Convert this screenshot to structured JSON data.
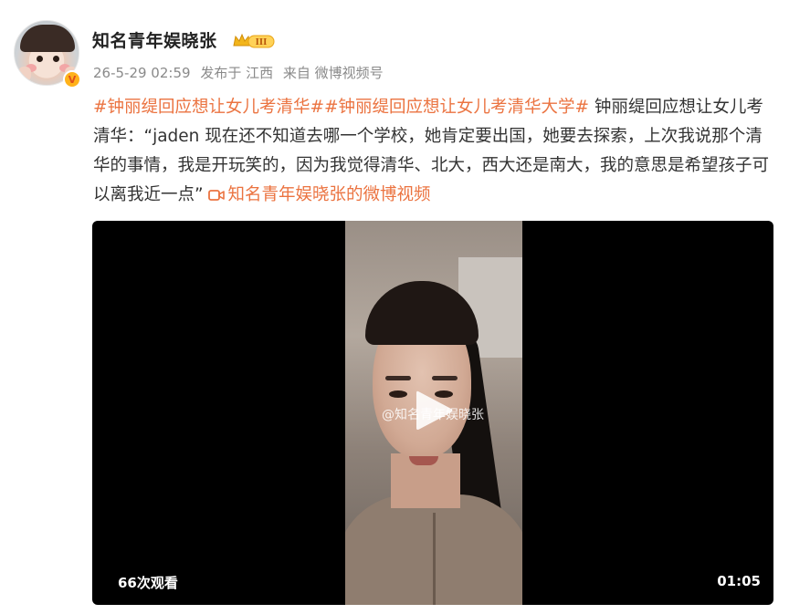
{
  "author": {
    "name": "知名青年娱晓张",
    "level_badge": "III",
    "verified_icon": "verified-badge-icon",
    "avatar_icon": "child-avatar"
  },
  "meta": {
    "time": "26-5-29 02:59",
    "location": "发布于 江西",
    "source": "来自 微博视频号"
  },
  "content": {
    "topic1": "#钟丽缇回应想让女儿考清华#",
    "topic2": "#钟丽缇回应想让女儿考清华大学#",
    "text": " 钟丽缇回应想让女儿考清华：“jaden 现在还不知道去哪一个学校，她肯定要出国，她要去探索，上次我说那个清华的事情，我是开玩笑的，因为我觉得清华、北大，西大还是南大，我的意思是希望孩子可以离我近一点” ",
    "video_link": "知名青年娱晓张的微博视频"
  },
  "video": {
    "watermark": "@知名青年娱晓张",
    "views": "66次观看",
    "duration": "01:05"
  },
  "colors": {
    "accent": "#eb7340",
    "badge_gold": "#ffb21a"
  }
}
